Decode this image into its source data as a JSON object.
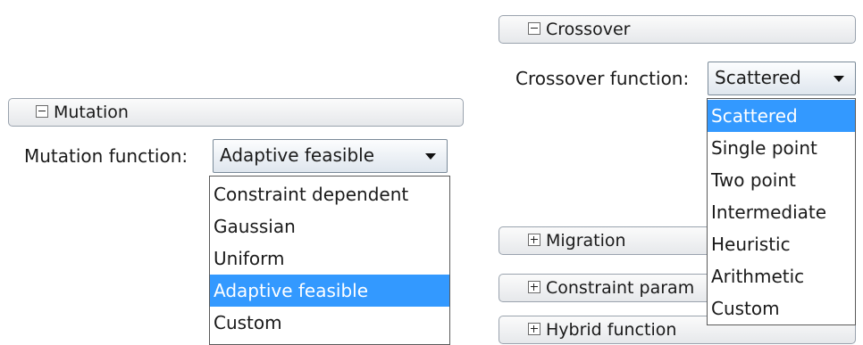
{
  "mutation": {
    "header": {
      "title": "Mutation"
    },
    "function_label": "Mutation function:",
    "selected": "Adaptive feasible",
    "options": [
      "Constraint dependent",
      "Gaussian",
      "Uniform",
      "Adaptive feasible",
      "Custom"
    ],
    "highlighted_option": "Adaptive feasible"
  },
  "crossover": {
    "header": {
      "title": "Crossover"
    },
    "function_label": "Crossover function:",
    "selected": "Scattered",
    "options": [
      "Scattered",
      "Single point",
      "Two point",
      "Intermediate",
      "Heuristic",
      "Arithmetic",
      "Custom"
    ],
    "highlighted_option": "Scattered"
  },
  "collapsed_sections": [
    {
      "title": "Migration"
    },
    {
      "title": "Constraint param"
    },
    {
      "title": "Hybrid function"
    }
  ],
  "colors": {
    "highlight": "#3399ff",
    "header_border": "#9aa3ae"
  },
  "icons": {
    "expanded": "minus-box-icon",
    "collapsed": "plus-box-icon"
  }
}
